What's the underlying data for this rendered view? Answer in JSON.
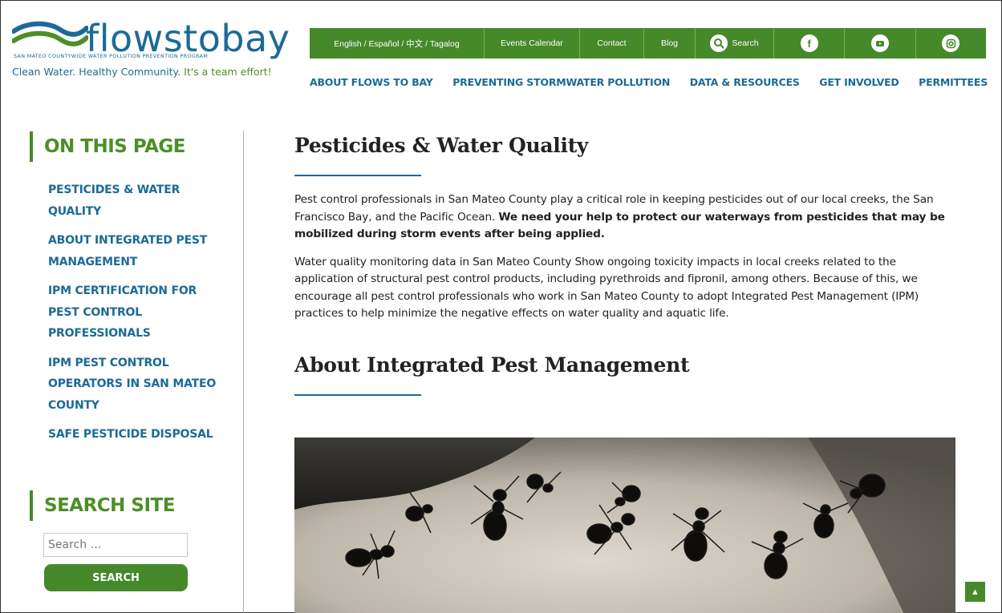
{
  "logo": {
    "name": "flowstobay",
    "subtitle": "SAN MATEO COUNTYWIDE WATER POLLUTION PREVENTION PROGRAM",
    "tagline_blue": "Clean Water. Healthy Community.",
    "tagline_green": " It's a team effort!"
  },
  "topbar": {
    "languages": "English  /  Español  /  中文  /  Tagalog",
    "events": "Events Calendar",
    "contact": "Contact",
    "blog": "Blog",
    "search": "Search"
  },
  "mainnav": [
    "ABOUT FLOWS TO BAY",
    "PREVENTING STORMWATER POLLUTION",
    "DATA & RESOURCES",
    "GET INVOLVED",
    "PERMITTEES"
  ],
  "sidebar": {
    "heading": "ON THIS PAGE",
    "items": [
      "PESTICIDES & WATER QUALITY",
      "ABOUT INTEGRATED PEST MANAGEMENT",
      "IPM CERTIFICATION FOR PEST CONTROL PROFESSIONALS",
      "IPM PEST CONTROL OPERATORS IN SAN MATEO COUNTY",
      "SAFE PESTICIDE DISPOSAL"
    ],
    "search_heading": "SEARCH SITE",
    "search_placeholder": "Search …",
    "search_button": "SEARCH"
  },
  "content": {
    "heading1": "Pesticides & Water Quality",
    "para1_normal": "Pest control professionals in San Mateo County play a critical role in keeping pesticides out of our local creeks, the San Francisco Bay, and the Pacific Ocean. ",
    "para1_bold": "We need your help to protect our waterways from pesticides that may be mobilized during storm events after being applied.",
    "para2": "Water quality monitoring data in San Mateo County Show ongoing toxicity impacts in local creeks related to the application of structural pest control products, including pyrethroids and fipronil, among others. Because of this, we encourage all pest control professionals who work in San Mateo County to adopt Integrated Pest Management (IPM) practices to help minimize the negative effects on water quality and aquatic life.",
    "heading2": "About Integrated Pest Management"
  },
  "colors": {
    "brand_green": "#46892b",
    "brand_blue": "#1c6a96"
  },
  "icons": [
    "search-icon",
    "facebook-icon",
    "youtube-icon",
    "instagram-icon",
    "chevron-up-icon"
  ]
}
